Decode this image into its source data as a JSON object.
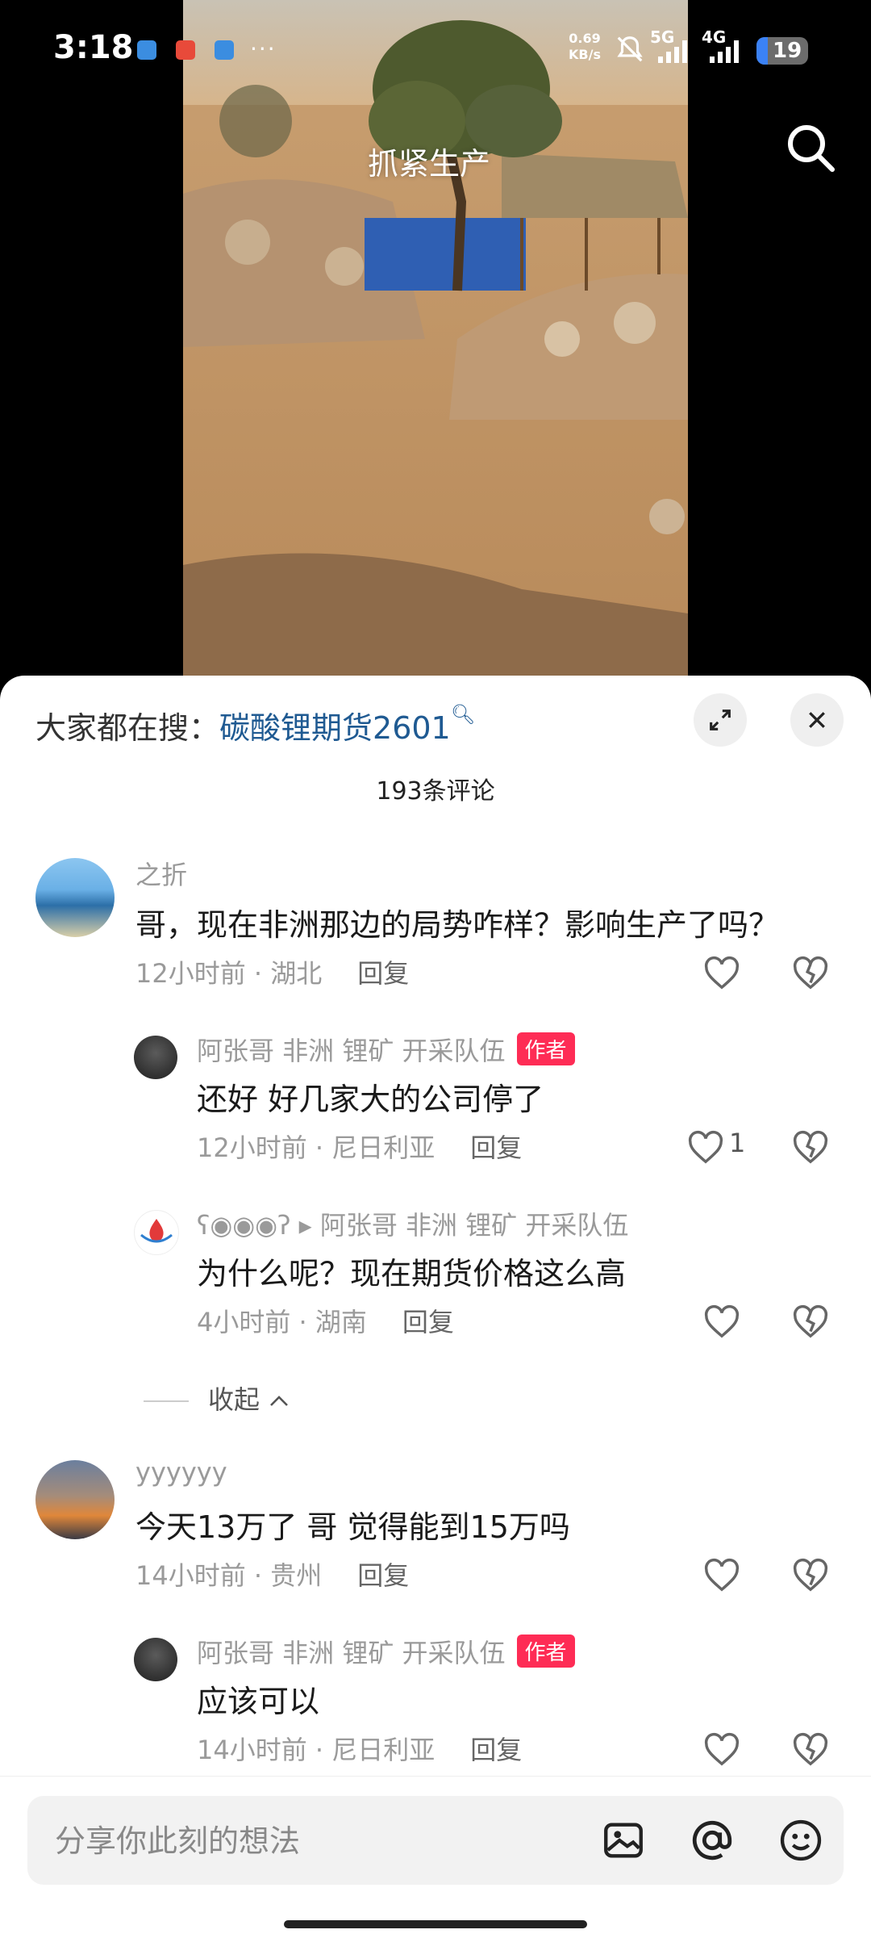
{
  "status_bar": {
    "time": "3:18",
    "net_speed_value": "0.69",
    "net_speed_unit": "KB/s",
    "sig1": "5G",
    "sig2": "4G",
    "battery": "19",
    "more": "···"
  },
  "video": {
    "overlay_text": "抓紧生产"
  },
  "comments_panel": {
    "trend_label": "大家都在搜：",
    "trend_keyword": "碳酸锂期货2601",
    "comment_count": "193条评论",
    "comments": [
      {
        "author": "之折",
        "text": "哥，现在非洲那边的局势咋样？影响生产了吗？",
        "time": "12小时前",
        "location": "湖北",
        "reply_label": "回复",
        "likes": ""
      },
      {
        "author": "阿张哥 非洲 锂矿 开采队伍",
        "badge": "作者",
        "text": "还好 好几家大的公司停了",
        "time": "12小时前",
        "location": "尼日利亚",
        "reply_label": "回复",
        "likes": "1"
      },
      {
        "author": "ʕ◉◉◉ʔ",
        "reply_to": "阿张哥 非洲 锂矿 开采队伍",
        "text": "为什么呢？现在期货价格这么高",
        "time": "4小时前",
        "location": "湖南",
        "reply_label": "回复",
        "likes": ""
      },
      {
        "author": "yyyyyy",
        "text": "今天13万了 哥 觉得能到15万吗",
        "time": "14小时前",
        "location": "贵州",
        "reply_label": "回复",
        "likes": ""
      },
      {
        "author": "阿张哥 非洲 锂矿 开采队伍",
        "badge": "作者",
        "text": "应该可以",
        "time": "14小时前",
        "location": "尼日利亚",
        "reply_label": "回复",
        "likes": ""
      }
    ],
    "collapse_label": "收起"
  },
  "input": {
    "placeholder": "分享你此刻的想法"
  },
  "colors": {
    "author_badge": "#fe2c55",
    "trend_keyword": "#1f5a92",
    "meta_text": "#9a9a9a"
  },
  "icons": [
    "search-icon",
    "expand-icon",
    "close-icon",
    "heart-icon",
    "broken-heart-icon",
    "image-icon",
    "at-icon",
    "emoji-icon",
    "chevron-up-icon"
  ]
}
